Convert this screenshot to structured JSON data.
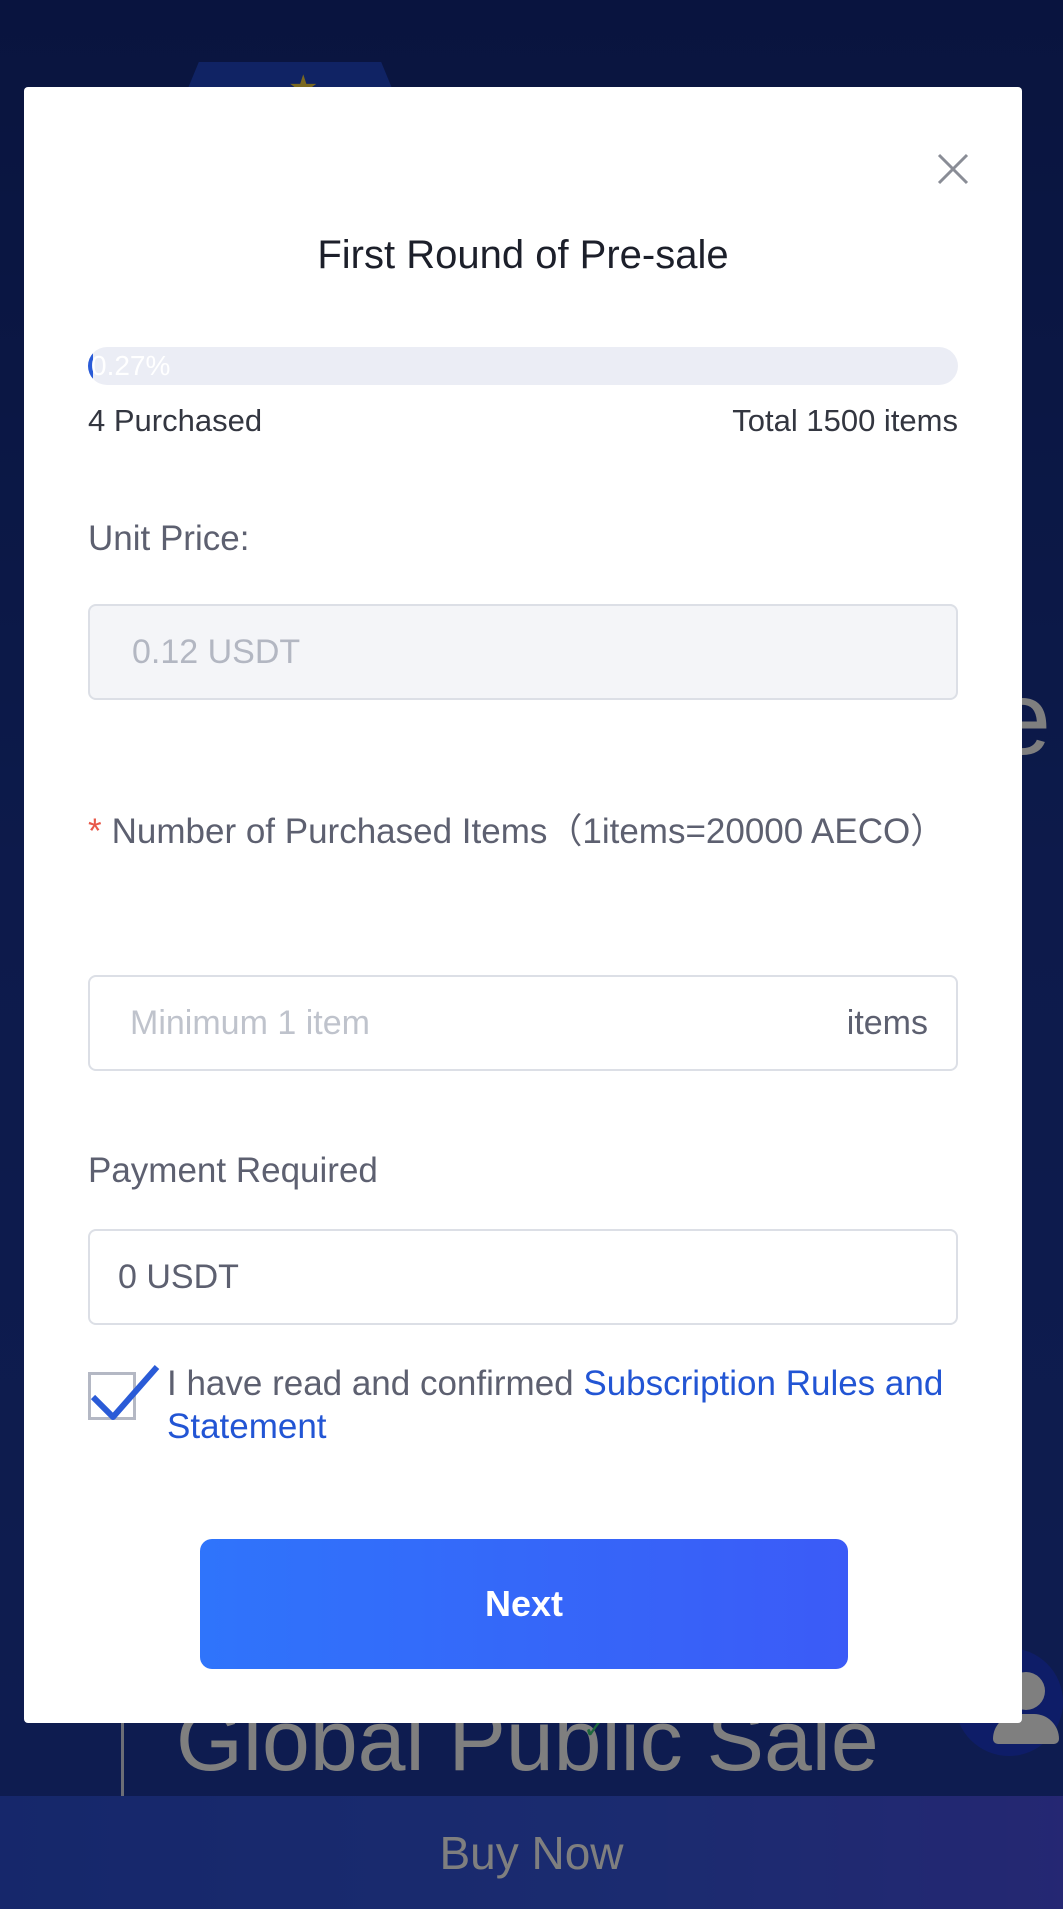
{
  "background": {
    "side_letter": "e",
    "headline": "Global Public Sale",
    "buy_now_label": "Buy Now"
  },
  "modal": {
    "title": "First Round of Pre-sale",
    "progress": {
      "percent_label": "0.27%",
      "fraction": 0.0027
    },
    "purchased": "4 Purchased",
    "total": "Total 1500 items",
    "unit_price": {
      "label": "Unit Price:",
      "value": "0.12 USDT"
    },
    "quantity": {
      "required_mark": "*",
      "label": "Number of Purchased Items（1items=20000 AECO）",
      "placeholder": "Minimum 1 item",
      "unit": "items"
    },
    "payment": {
      "label": "Payment Required",
      "value": "0 USDT"
    },
    "agreement": {
      "checked": true,
      "text": "I have read and confirmed ",
      "link": "Subscription Rules and Statement"
    },
    "next_label": "Next"
  },
  "colors": {
    "accent": "#2255d4",
    "button_start": "#2f74fb",
    "button_end": "#3b5bf7",
    "required": "#e8584a"
  }
}
